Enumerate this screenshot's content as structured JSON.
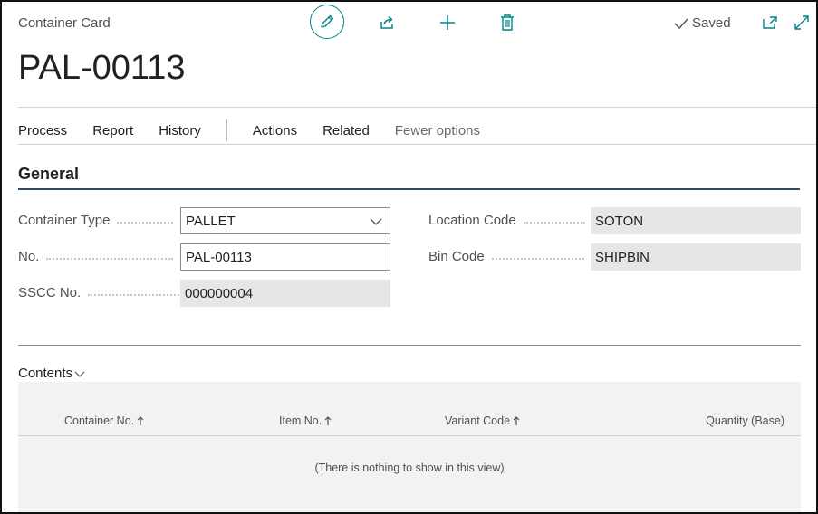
{
  "header": {
    "caption": "Container Card",
    "title": "PAL-00113",
    "saved_label": "Saved"
  },
  "toolbar": {
    "edit_icon": "pencil-icon",
    "share_icon": "share-icon",
    "new_icon": "plus-icon",
    "delete_icon": "trash-icon",
    "open_new_window_icon": "open-in-new-window-icon",
    "expand_icon": "expand-icon"
  },
  "menu": {
    "items": [
      "Process",
      "Report",
      "History"
    ],
    "items2": [
      "Actions",
      "Related"
    ],
    "fewer_options": "Fewer options"
  },
  "general": {
    "title": "General",
    "container_type_label": "Container Type",
    "container_type_value": "PALLET",
    "no_label": "No.",
    "no_value": "PAL-00113",
    "sscc_label": "SSCC No.",
    "sscc_value": "000000004",
    "location_code_label": "Location Code",
    "location_code_value": "SOTON",
    "bin_code_label": "Bin Code",
    "bin_code_value": "SHIPBIN"
  },
  "contents": {
    "title": "Contents",
    "columns": [
      "Container No.",
      "Item No.",
      "Variant Code",
      "Quantity (Base)"
    ],
    "empty_message": "(There is nothing to show in this view)"
  },
  "colors": {
    "accent": "#008489",
    "section_line": "#34495e",
    "readonly_bg": "#e6e6e6"
  }
}
